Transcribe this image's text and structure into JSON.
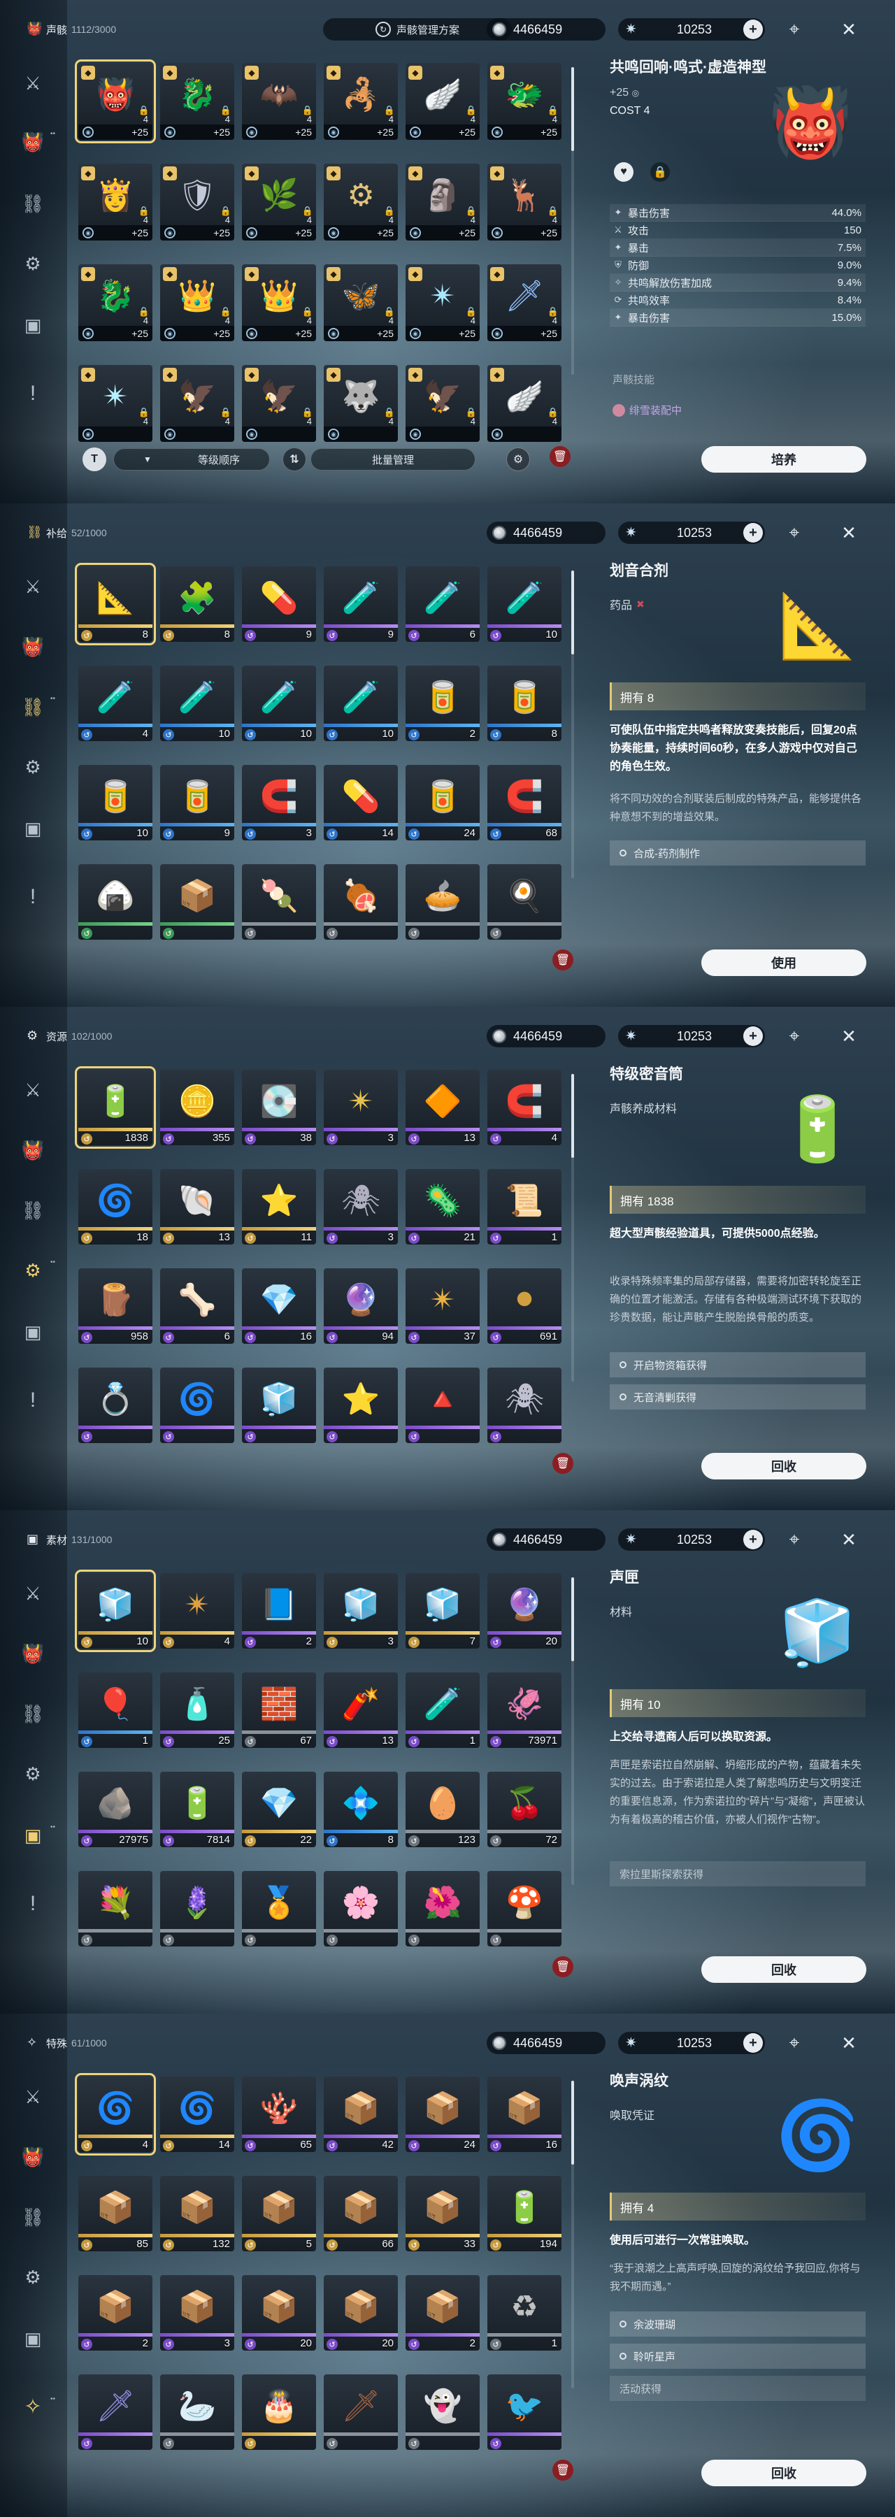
{
  "topbar": {
    "coins": "4466459",
    "astrite": "10253",
    "scheme_label": "声骸管理方案"
  },
  "sidebar": {
    "badge_glyph": "!"
  },
  "echo": {
    "title": "声骸",
    "count": "1112/3000",
    "rows": [
      [
        {
          "lv": "+25",
          "cost": "4",
          "q": "gold",
          "art": "👹",
          "color": "#d64a4a"
        },
        {
          "lv": "+25",
          "cost": "4",
          "q": "gold",
          "art": "🐉",
          "color": "#9a4a5a"
        },
        {
          "lv": "+25",
          "cost": "4",
          "q": "gold",
          "art": "🦇",
          "color": "#6db0d8"
        },
        {
          "lv": "+25",
          "cost": "4",
          "q": "gold",
          "art": "🦂",
          "color": "#d8b35a"
        },
        {
          "lv": "+25",
          "cost": "4",
          "q": "gold",
          "art": "🪽",
          "color": "#c6d4e4"
        },
        {
          "lv": "+25",
          "cost": "4",
          "q": "gold",
          "art": "🐲",
          "color": "#8ce0f0"
        }
      ],
      [
        {
          "lv": "+25",
          "cost": "4",
          "q": "gold",
          "art": "👸",
          "color": "#f0f0ff"
        },
        {
          "lv": "+25",
          "cost": "4",
          "q": "gold",
          "art": "🛡",
          "color": "#c4c8d8"
        },
        {
          "lv": "+25",
          "cost": "4",
          "q": "gold",
          "art": "🌿",
          "color": "#62d68c"
        },
        {
          "lv": "+25",
          "cost": "4",
          "q": "gold",
          "art": "⚙",
          "color": "#e0c27a"
        },
        {
          "lv": "+25",
          "cost": "4",
          "q": "gold",
          "art": "🗿",
          "color": "#9aa6c0"
        },
        {
          "lv": "+25",
          "cost": "4",
          "q": "gold",
          "art": "🦌",
          "color": "#e0d0b0"
        }
      ],
      [
        {
          "lv": "+25",
          "cost": "4",
          "q": "gold",
          "art": "🐉",
          "color": "#7ad2ff"
        },
        {
          "lv": "+25",
          "cost": "4",
          "q": "gold",
          "art": "👑",
          "color": "#d0c0f0"
        },
        {
          "lv": "+25",
          "cost": "4",
          "q": "gold",
          "art": "👑",
          "color": "#e0d0ff"
        },
        {
          "lv": "+25",
          "cost": "4",
          "q": "gold",
          "art": "🦋",
          "color": "#bfe6ff"
        },
        {
          "lv": "+25",
          "cost": "4",
          "q": "gold",
          "art": "✴",
          "color": "#a8e8ff"
        },
        {
          "lv": "+25",
          "cost": "4",
          "q": "gold",
          "art": "🗡",
          "color": "#8fc0ff"
        }
      ],
      [
        {
          "lv": "",
          "cost": "4",
          "q": "gold",
          "art": "✴",
          "color": "#b4f0ff"
        },
        {
          "lv": "",
          "cost": "4",
          "q": "gold",
          "art": "🦅",
          "color": "#b0a0c8"
        },
        {
          "lv": "",
          "cost": "4",
          "q": "gold",
          "art": "🦅",
          "color": "#c0b0d8"
        },
        {
          "lv": "",
          "cost": "4",
          "q": "gold",
          "art": "🐺",
          "color": "#e0b050"
        },
        {
          "lv": "",
          "cost": "4",
          "q": "gold",
          "art": "🦅",
          "color": "#d0d0d0"
        },
        {
          "lv": "",
          "cost": "4",
          "q": "gold",
          "art": "🪽",
          "color": "#d8e4f0"
        }
      ]
    ],
    "sort_label": "等级顺序",
    "batch_label": "批量管理",
    "detail": {
      "name": "共鸣回响·鸣式·虚造神型",
      "level": "+25",
      "cost": "COST 4",
      "stats": [
        {
          "k": "暴击伤害",
          "v": "44.0%",
          "icon": "✦"
        },
        {
          "k": "攻击",
          "v": "150",
          "icon": "⚔"
        },
        {
          "k": "暴击",
          "v": "7.5%",
          "icon": "✦"
        },
        {
          "k": "防御",
          "v": "9.0%",
          "icon": "⛨"
        },
        {
          "k": "共鸣解放伤害加成",
          "v": "9.4%",
          "icon": "✧"
        },
        {
          "k": "共鸣效率",
          "v": "8.4%",
          "icon": "⟳"
        },
        {
          "k": "暴击伤害",
          "v": "15.0%",
          "icon": "✦"
        }
      ],
      "skill_label": "声骸技能",
      "equipped": "绯雪装配中",
      "action": "培养"
    }
  },
  "supply": {
    "title": "补给",
    "count": "52/1000",
    "rows": [
      [
        {
          "qty": "8",
          "q": "gold",
          "art": "📐",
          "color": "#d8a64a"
        },
        {
          "qty": "8",
          "q": "gold",
          "art": "🧩",
          "color": "#5ad08a"
        },
        {
          "qty": "9",
          "q": "purple",
          "art": "💊",
          "color": "#b08ce0"
        },
        {
          "qty": "9",
          "q": "purple",
          "art": "🧪",
          "color": "#d05a7a"
        },
        {
          "qty": "6",
          "q": "purple",
          "art": "🧪",
          "color": "#5ad0c0"
        },
        {
          "qty": "10",
          "q": "purple",
          "art": "🧪",
          "color": "#c07ae0"
        }
      ],
      [
        {
          "qty": "4",
          "q": "blue",
          "art": "🧪",
          "color": "#a08ce8"
        },
        {
          "qty": "10",
          "q": "blue",
          "art": "🧪",
          "color": "#d0d0e0"
        },
        {
          "qty": "10",
          "q": "blue",
          "art": "🧪",
          "color": "#7ad0c8"
        },
        {
          "qty": "10",
          "q": "blue",
          "art": "🧪",
          "color": "#8ad8e8"
        },
        {
          "qty": "2",
          "q": "blue",
          "art": "🥫",
          "color": "#d04a4a"
        },
        {
          "qty": "8",
          "q": "blue",
          "art": "🥫",
          "color": "#4ab0a0"
        }
      ],
      [
        {
          "qty": "10",
          "q": "blue",
          "art": "🥫",
          "color": "#8a5ad0"
        },
        {
          "qty": "9",
          "q": "blue",
          "art": "🥫",
          "color": "#9a7ab8"
        },
        {
          "qty": "3",
          "q": "blue",
          "art": "🧲",
          "color": "#60b0e0"
        },
        {
          "qty": "14",
          "q": "blue",
          "art": "💊",
          "color": "#b0c8e0"
        },
        {
          "qty": "24",
          "q": "blue",
          "art": "🥫",
          "color": "#5a9ad0"
        },
        {
          "qty": "68",
          "q": "blue",
          "art": "🧲",
          "color": "#5ab0a0"
        }
      ],
      [
        {
          "qty": "",
          "q": "green",
          "art": "🍙",
          "color": "#a8d8c8"
        },
        {
          "qty": "",
          "q": "green",
          "art": "📦",
          "color": "#5aa070"
        },
        {
          "qty": "",
          "q": "gray",
          "art": "🍡",
          "color": "#c0a0a0"
        },
        {
          "qty": "",
          "q": "gray",
          "art": "🍖",
          "color": "#d06a4a"
        },
        {
          "qty": "",
          "q": "gray",
          "art": "🥧",
          "color": "#e0b070"
        },
        {
          "qty": "",
          "q": "gray",
          "art": "🍳",
          "color": "#e8c04a"
        }
      ]
    ],
    "detail": {
      "name": "划音合剂",
      "type": "药品",
      "own": "拥有 8",
      "bold": "可使队伍中指定共鸣者释放变奏技能后，回复20点协奏能量，持续时间60秒，在多人游戏中仅对自己的角色生效。",
      "desc": "将不同功效的合剂联装后制成的特殊产品，能够提供各种意想不到的增益效果。",
      "sources": [
        "合成-药剂制作"
      ],
      "action": "使用"
    }
  },
  "resource": {
    "title": "资源",
    "count": "102/1000",
    "rows": [
      [
        {
          "qty": "1838",
          "q": "gold",
          "art": "🔋",
          "color": "#e8d8a8"
        },
        {
          "qty": "355",
          "q": "purple",
          "art": "🪙",
          "color": "#d0a050"
        },
        {
          "qty": "38",
          "q": "purple",
          "art": "💽",
          "color": "#c0c8d0"
        },
        {
          "qty": "3",
          "q": "purple",
          "art": "✴",
          "color": "#e8c050"
        },
        {
          "qty": "13",
          "q": "purple",
          "art": "🔶",
          "color": "#e0a040"
        },
        {
          "qty": "4",
          "q": "purple",
          "art": "🧲",
          "color": "#d05050"
        }
      ],
      [
        {
          "qty": "18",
          "q": "gold",
          "art": "🌀",
          "color": "#e0a030"
        },
        {
          "qty": "13",
          "q": "gold",
          "art": "🐚",
          "color": "#90e0e8"
        },
        {
          "qty": "11",
          "q": "gold",
          "art": "⭐",
          "color": "#e8b060"
        },
        {
          "qty": "3",
          "q": "purple",
          "art": "🕷",
          "color": "#b0b0c0"
        },
        {
          "qty": "21",
          "q": "purple",
          "art": "🦠",
          "color": "#d04040"
        },
        {
          "qty": "1",
          "q": "purple",
          "art": "📜",
          "color": "#e0b060"
        }
      ],
      [
        {
          "qty": "958",
          "q": "purple",
          "art": "🪵",
          "color": "#c09070"
        },
        {
          "qty": "6",
          "q": "purple",
          "art": "🦴",
          "color": "#e0b050"
        },
        {
          "qty": "16",
          "q": "purple",
          "art": "💎",
          "color": "#b070e0"
        },
        {
          "qty": "94",
          "q": "purple",
          "art": "🔮",
          "color": "#d070c0"
        },
        {
          "qty": "37",
          "q": "purple",
          "art": "✴",
          "color": "#e8b040"
        },
        {
          "qty": "691",
          "q": "purple",
          "art": "⚫",
          "color": "#d0a040"
        }
      ],
      [
        {
          "qty": "",
          "q": "purple",
          "art": "💍",
          "color": "#a0a8b0"
        },
        {
          "qty": "",
          "q": "purple",
          "art": "🌀",
          "color": "#e0a040"
        },
        {
          "qty": "",
          "q": "purple",
          "art": "🧊",
          "color": "#b0e0f0"
        },
        {
          "qty": "",
          "q": "purple",
          "art": "⭐",
          "color": "#e0c070"
        },
        {
          "qty": "",
          "q": "purple",
          "art": "🔺",
          "color": "#e8b040"
        },
        {
          "qty": "",
          "q": "purple",
          "art": "🕷",
          "color": "#c0c0d0"
        }
      ]
    ],
    "detail": {
      "name": "特级密音筒",
      "type": "声骸养成材料",
      "own": "拥有 1838",
      "bold": "超大型声骸经验道具，可提供5000点经验。",
      "desc": "收录特殊频率集的局部存储器，需要将加密转轮旋至正确的位置才能激活。存储有各种极端测试环境下获取的珍贵数据，能让声骸产生脱胎换骨般的质变。",
      "sources": [
        "开启物资箱获得",
        "无音清剿获得"
      ],
      "action": "回收"
    }
  },
  "material": {
    "title": "素材",
    "count": "131/1000",
    "rows": [
      [
        {
          "qty": "10",
          "q": "gold",
          "art": "🧊",
          "color": "#f0d070"
        },
        {
          "qty": "4",
          "q": "gold",
          "art": "✴",
          "color": "#e0a040"
        },
        {
          "qty": "2",
          "q": "purple",
          "art": "📘",
          "color": "#9080e0"
        },
        {
          "qty": "3",
          "q": "gold",
          "art": "🧊",
          "color": "#e0d090"
        },
        {
          "qty": "7",
          "q": "gold",
          "art": "🧊",
          "color": "#e8d070"
        },
        {
          "qty": "20",
          "q": "purple",
          "art": "🔮",
          "color": "#a080e0"
        }
      ],
      [
        {
          "qty": "1",
          "q": "blue",
          "art": "🎈",
          "color": "#b0e0f0"
        },
        {
          "qty": "25",
          "q": "purple",
          "art": "🧴",
          "color": "#e0a040"
        },
        {
          "qty": "67",
          "q": "gray",
          "art": "🧱",
          "color": "#c0c4c8"
        },
        {
          "qty": "13",
          "q": "purple",
          "art": "🧨",
          "color": "#e06030"
        },
        {
          "qty": "1",
          "q": "purple",
          "art": "🧪",
          "color": "#e0b030"
        },
        {
          "qty": "73971",
          "q": "purple",
          "art": "🦑",
          "color": "#8090e0"
        }
      ],
      [
        {
          "qty": "27975",
          "q": "purple",
          "art": "🪨",
          "color": "#a0a090"
        },
        {
          "qty": "7814",
          "q": "purple",
          "art": "🔋",
          "color": "#50c0a0"
        },
        {
          "qty": "22",
          "q": "gold",
          "art": "💎",
          "color": "#e0c080"
        },
        {
          "qty": "8",
          "q": "blue",
          "art": "💠",
          "color": "#60c0e0"
        },
        {
          "qty": "123",
          "q": "gray",
          "art": "🥚",
          "color": "#e0c090"
        },
        {
          "qty": "72",
          "q": "gray",
          "art": "🍒",
          "color": "#e04040"
        }
      ],
      [
        {
          "qty": "",
          "q": "gray",
          "art": "💐",
          "color": "#5080e0"
        },
        {
          "qty": "",
          "q": "gray",
          "art": "🪻",
          "color": "#c0c0d0"
        },
        {
          "qty": "",
          "q": "gray",
          "art": "🏅",
          "color": "#e0b040"
        },
        {
          "qty": "",
          "q": "gray",
          "art": "🌸",
          "color": "#e080a0"
        },
        {
          "qty": "",
          "q": "gray",
          "art": "🌺",
          "color": "#e04040"
        },
        {
          "qty": "",
          "q": "gray",
          "art": "🍄",
          "color": "#c0c0c0"
        }
      ]
    ],
    "detail": {
      "name": "声匣",
      "type": "材料",
      "own": "拥有 10",
      "bold": "上交给寻遗商人后可以换取资源。",
      "desc": "声匣是索诺拉自然崩解、坍缩形成的产物，蕴藏着未失实的过去。由于索诺拉是人类了解悲鸣历史与文明变迁的重要信息源，作为索诺拉的“碎片”与“凝缩”，声匣被认为有着极高的稽古价值，亦被人们视作“古物”。",
      "sources_plain": [
        "索拉里斯探索获得"
      ],
      "action": "回收"
    }
  },
  "special": {
    "title": "特殊",
    "count": "61/1000",
    "rows": [
      [
        {
          "qty": "4",
          "q": "gold",
          "art": "🌀",
          "color": "#60d0d0"
        },
        {
          "qty": "14",
          "q": "gold",
          "art": "🌀",
          "color": "#e0b040"
        },
        {
          "qty": "65",
          "q": "purple",
          "art": "🪸",
          "color": "#b0a0f0"
        },
        {
          "qty": "42",
          "q": "purple",
          "art": "📦",
          "color": "#b0b0c0"
        },
        {
          "qty": "24",
          "q": "purple",
          "art": "📦",
          "color": "#a0a0b0"
        },
        {
          "qty": "16",
          "q": "purple",
          "art": "📦",
          "color": "#a0a0b0"
        }
      ],
      [
        {
          "qty": "85",
          "q": "gold",
          "art": "📦",
          "color": "#e0c040"
        },
        {
          "qty": "132",
          "q": "gold",
          "art": "📦",
          "color": "#e8c040"
        },
        {
          "qty": "5",
          "q": "gold",
          "art": "📦",
          "color": "#e0c040"
        },
        {
          "qty": "66",
          "q": "gold",
          "art": "📦",
          "color": "#e0c040"
        },
        {
          "qty": "33",
          "q": "gold",
          "art": "📦",
          "color": "#e0c040"
        },
        {
          "qty": "194",
          "q": "gold",
          "art": "🔋",
          "color": "#e0c040"
        }
      ],
      [
        {
          "qty": "2",
          "q": "purple",
          "art": "📦",
          "color": "#a0a0a8"
        },
        {
          "qty": "3",
          "q": "purple",
          "art": "📦",
          "color": "#c0a0a0"
        },
        {
          "qty": "20",
          "q": "purple",
          "art": "📦",
          "color": "#b090a0"
        },
        {
          "qty": "20",
          "q": "purple",
          "art": "📦",
          "color": "#a0a0a8"
        },
        {
          "qty": "2",
          "q": "purple",
          "art": "📦",
          "color": "#b0b0b8"
        },
        {
          "qty": "1",
          "q": "gray",
          "art": "♻",
          "color": "#c0c0c0"
        }
      ],
      [
        {
          "qty": "",
          "q": "purple",
          "art": "🗡",
          "color": "#9090e0"
        },
        {
          "qty": "",
          "q": "gray",
          "art": "🦢",
          "color": "#d0d0e0"
        },
        {
          "qty": "",
          "q": "gold",
          "art": "🎂",
          "color": "#c08060"
        },
        {
          "qty": "",
          "q": "gray",
          "art": "🗡",
          "color": "#a06040"
        },
        {
          "qty": "",
          "q": "gray",
          "art": "👻",
          "color": "#f0f0f8"
        },
        {
          "qty": "",
          "q": "purple",
          "art": "🐦",
          "color": "#6080e0"
        }
      ]
    ],
    "detail": {
      "name": "唤声涡纹",
      "type": "唤取凭证",
      "own": "拥有 4",
      "bold": "使用后可进行一次常驻唤取。",
      "desc": "“我于浪潮之上高声呼唤,回旋的涡纹给予我回应,你将与我不期而遇。”",
      "sources": [
        "余波珊瑚",
        "聆听星声"
      ],
      "sources_plain": [
        "活动获得"
      ],
      "action": "回收"
    }
  }
}
